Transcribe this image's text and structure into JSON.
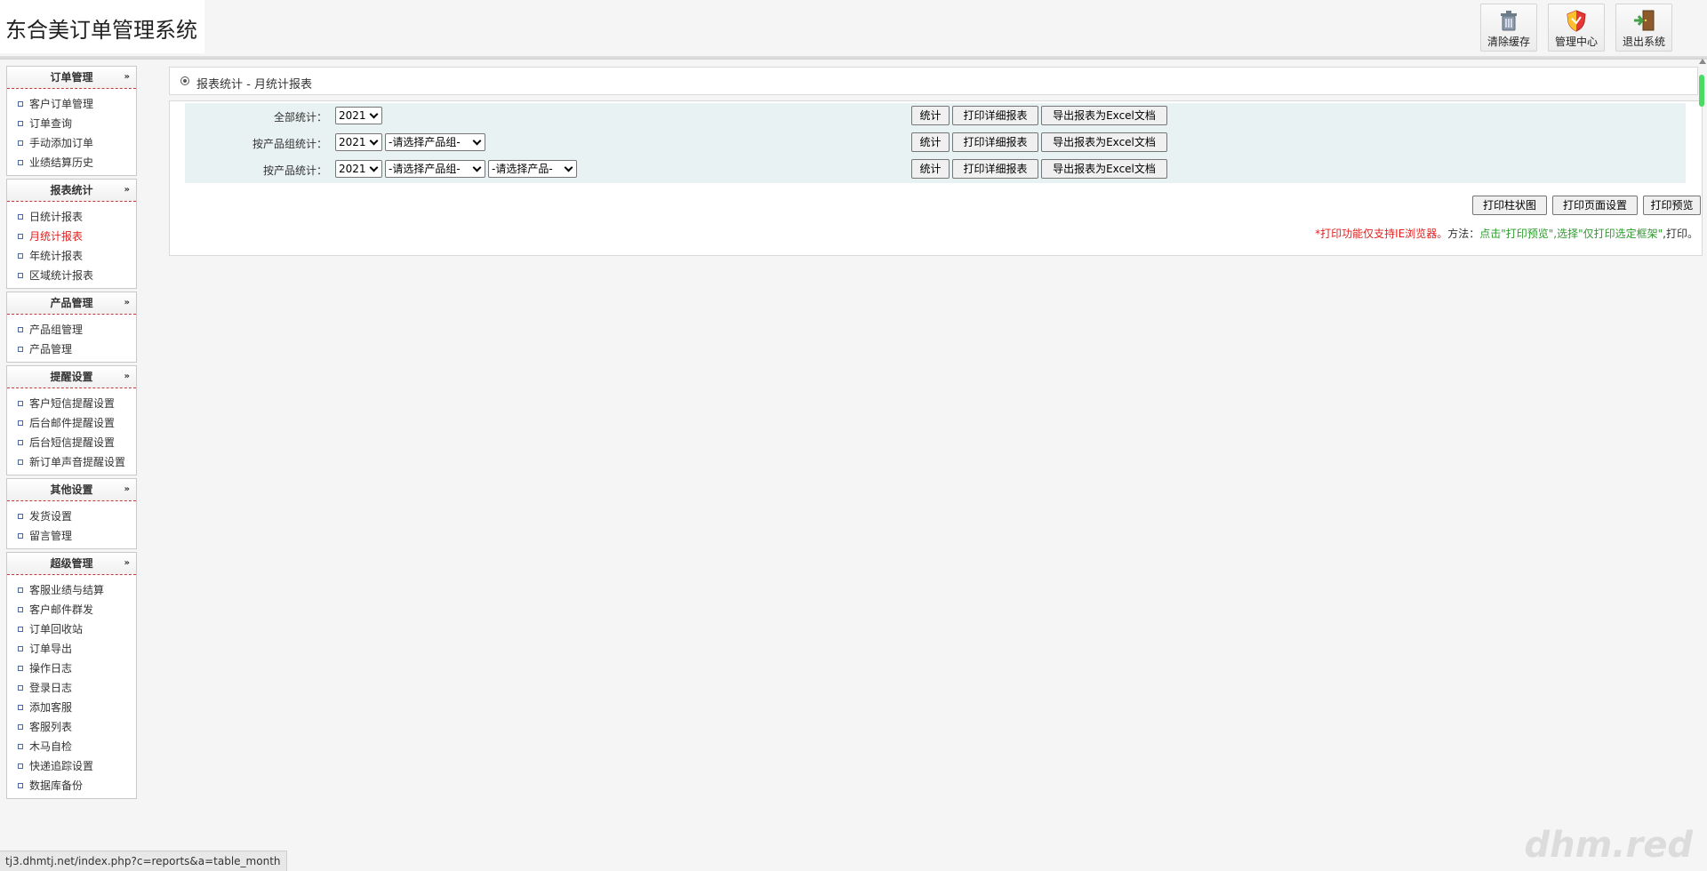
{
  "header": {
    "title": "东合美订单管理系统",
    "buttons": [
      {
        "label": "清除缓存",
        "icon": "trash-icon"
      },
      {
        "label": "管理中心",
        "icon": "shield-icon"
      },
      {
        "label": "退出系统",
        "icon": "exit-door-icon"
      }
    ]
  },
  "sidebar": {
    "panels": [
      {
        "title": "订单管理",
        "items": [
          "客户订单管理",
          "订单查询",
          "手动添加订单",
          "业绩结算历史"
        ]
      },
      {
        "title": "报表统计",
        "items": [
          "日统计报表",
          "月统计报表",
          "年统计报表",
          "区域统计报表"
        ],
        "active": "月统计报表"
      },
      {
        "title": "产品管理",
        "items": [
          "产品组管理",
          "产品管理"
        ]
      },
      {
        "title": "提醒设置",
        "items": [
          "客户短信提醒设置",
          "后台邮件提醒设置",
          "后台短信提醒设置",
          "新订单声音提醒设置"
        ]
      },
      {
        "title": "其他设置",
        "items": [
          "发货设置",
          "留言管理"
        ]
      },
      {
        "title": "超级管理",
        "items": [
          "客服业绩与结算",
          "客户邮件群发",
          "订单回收站",
          "订单导出",
          "操作日志",
          "登录日志",
          "添加客服",
          "客服列表",
          "木马自检",
          "快递追踪设置",
          "数据库备份"
        ]
      }
    ]
  },
  "breadcrumb": "报表统计 - 月统计报表",
  "filters": {
    "rows": [
      {
        "label": "全部统计：",
        "year": "2021",
        "group": "",
        "product": ""
      },
      {
        "label": "按产品组统计：",
        "year": "2021",
        "group": "-请选择产品组-",
        "product": ""
      },
      {
        "label": "按产品统计：",
        "year": "2021",
        "group": "-请选择产品组-",
        "product": "-请选择产品-"
      }
    ],
    "stat_label": "统计",
    "print_detail_label": "打印详细报表",
    "export_label": "导出报表为Excel文档"
  },
  "print_buttons": {
    "bar_chart": "打印柱状图",
    "page_setup": "打印页面设置",
    "preview": "打印预览"
  },
  "print_note": {
    "part1": "*打印功能仅支持IE浏览器。",
    "part2": "方法：",
    "part3": "点击\"打印预览\",选择\"仅打印选定框架\"",
    "part4": ",打印。"
  },
  "status_url": "tj3.dhmtj.net/index.php?c=reports&a=table_month",
  "watermark": "dhm.red"
}
